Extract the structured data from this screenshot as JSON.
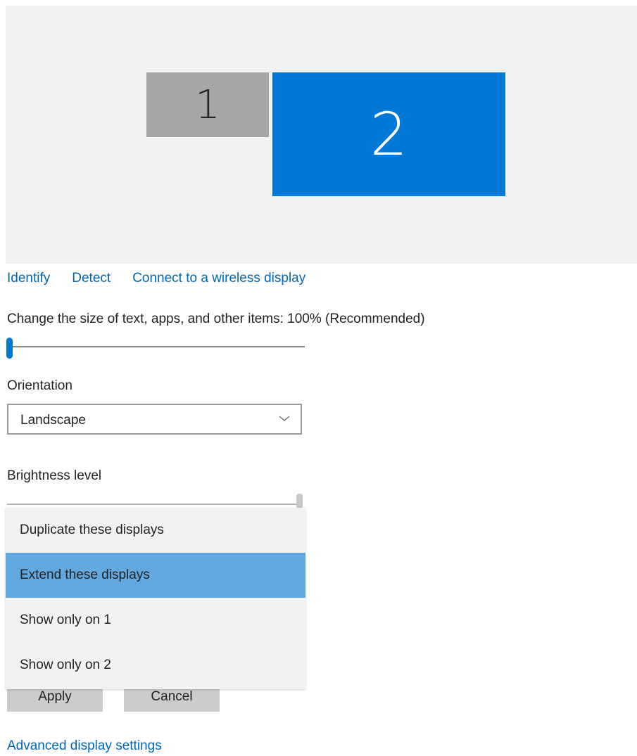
{
  "monitors": [
    {
      "label": "1",
      "color": "#a6a6a6",
      "selected": false
    },
    {
      "label": "2",
      "color": "#0078d7",
      "selected": true
    }
  ],
  "links": {
    "identify": "Identify",
    "detect": "Detect",
    "connect_wireless": "Connect to a wireless display"
  },
  "scale": {
    "label": "Change the size of text, apps, and other items: 100% (Recommended)",
    "slider_position": 0
  },
  "orientation": {
    "label": "Orientation",
    "value": "Landscape",
    "icon": "chevron-down-icon"
  },
  "brightness": {
    "label": "Brightness level",
    "slider_position": 1
  },
  "multiple_displays_menu": {
    "options": [
      "Duplicate these displays",
      "Extend these displays",
      "Show only on 1",
      "Show only on 2"
    ],
    "selected": "Extend these displays",
    "highlight_color": "#61a7e0"
  },
  "buttons": {
    "apply": "Apply",
    "cancel": "Cancel"
  },
  "advanced_link": "Advanced display settings",
  "accent_color": "#0078d7",
  "link_color": "#0066b4"
}
